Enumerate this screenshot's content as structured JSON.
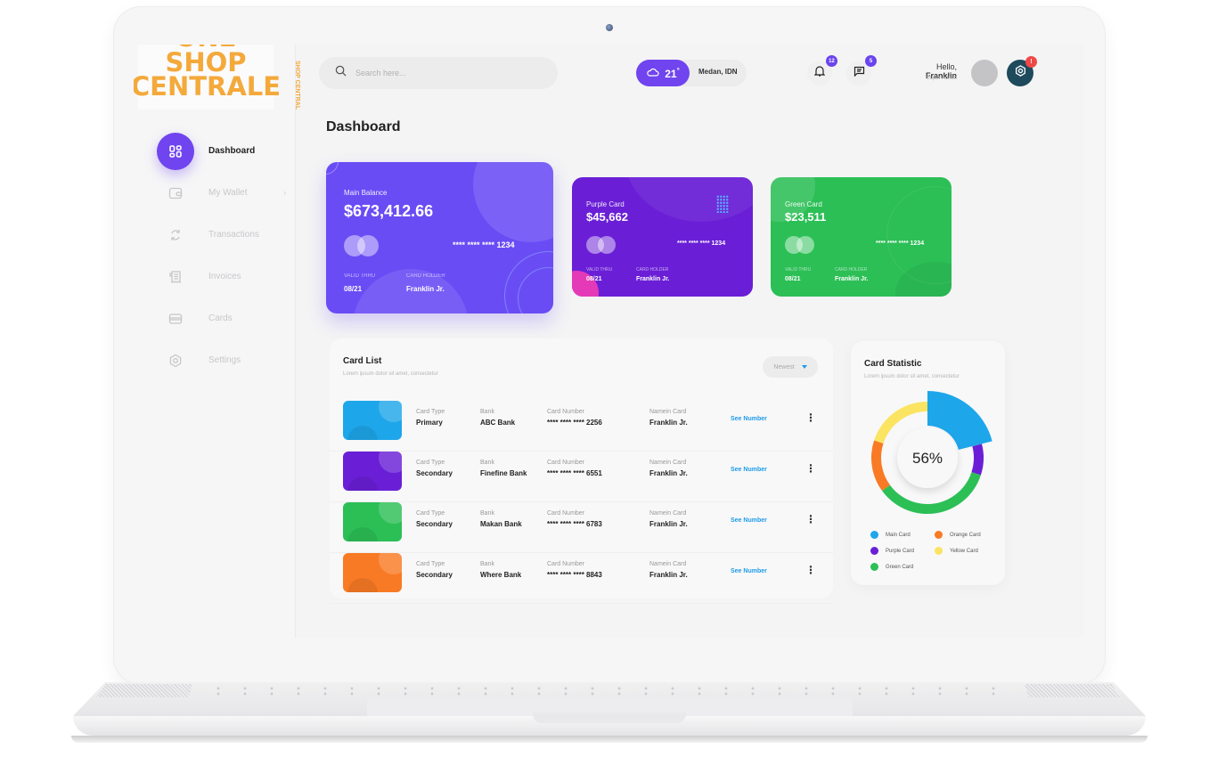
{
  "brand": {
    "logo_lines": [
      "ONE",
      "SHOP",
      "CENTRALE"
    ],
    "side_text": "SHOP CENTRAL",
    "color": "#f4a93b"
  },
  "sidebar": {
    "items": [
      {
        "label": "Dashboard",
        "icon": "dashboard-icon",
        "active": true
      },
      {
        "label": "My Wallet",
        "icon": "wallet-icon",
        "has_chevron": true
      },
      {
        "label": "Transactions",
        "icon": "transactions-icon"
      },
      {
        "label": "Invoices",
        "icon": "invoice-icon"
      },
      {
        "label": "Cards",
        "icon": "card-icon"
      },
      {
        "label": "Settings",
        "icon": "settings-icon"
      }
    ],
    "chevron": "›"
  },
  "header": {
    "search_placeholder": "Search here...",
    "weather": {
      "temp": "21",
      "degree": "°",
      "city": "Medan, IDN"
    },
    "notifications_count": "12",
    "messages_count": "5",
    "greeting": "Hello,",
    "user_name": "Franklin",
    "role": "Super Admin",
    "settings_badge": "!"
  },
  "page": {
    "title": "Dashboard"
  },
  "cards": [
    {
      "label": "Main Balance",
      "amount": "$673,412.66",
      "number": "**** **** **** 1234",
      "valid_label": "VALID THRU",
      "valid": "08/21",
      "holder_label": "CARD HOLDER",
      "holder": "Franklin Jr."
    },
    {
      "label": "Purple Card",
      "amount": "$45,662",
      "number": "**** **** **** 1234",
      "valid_label": "VALID THRU",
      "valid": "08/21",
      "holder_label": "CARD HOLDER",
      "holder": "Franklin Jr."
    },
    {
      "label": "Green Card",
      "amount": "$23,511",
      "number": "**** **** **** 1234",
      "valid_label": "VALID THRU",
      "valid": "08/21",
      "holder_label": "CARD HOLDER",
      "holder": "Franklin Jr."
    }
  ],
  "card_list": {
    "title": "Card List",
    "subtitle": "Lorem ipsum dolor sit amet, consectetur",
    "sort": "Newest",
    "columns": [
      "Card Type",
      "Bank",
      "Card Number",
      "Namein Card"
    ],
    "action": "See Number",
    "more": "⋮",
    "rows": [
      {
        "type": "Primary",
        "bank": "ABC Bank",
        "number": "**** **** **** 2256",
        "name": "Franklin Jr.",
        "color": "#1ea6ea"
      },
      {
        "type": "Secondary",
        "bank": "Finefine Bank",
        "number": "**** **** **** 6551",
        "name": "Franklin Jr.",
        "color": "#6a1fd6"
      },
      {
        "type": "Secondary",
        "bank": "Makan Bank",
        "number": "**** **** **** 6783",
        "name": "Franklin Jr.",
        "color": "#2cbf56"
      },
      {
        "type": "Secondary",
        "bank": "Where Bank",
        "number": "**** **** **** 8843",
        "name": "Franklin Jr.",
        "color": "#f97a24"
      }
    ]
  },
  "card_statistic": {
    "title": "Card Statistic",
    "subtitle": "Lorem ipsum dolor sit amet, consectetur",
    "center_label": "56%",
    "segments": [
      {
        "name": "Main Card",
        "value": 21,
        "color": "#1ea6ea",
        "highlighted": true
      },
      {
        "name": "Purple Card",
        "value": 9,
        "color": "#6a1fd6"
      },
      {
        "name": "Green Card",
        "value": 35,
        "color": "#2cbf56"
      },
      {
        "name": "Orange Card",
        "value": 15,
        "color": "#f97a24"
      },
      {
        "name": "Yellow Card",
        "value": 20,
        "color": "#fbe462"
      }
    ]
  }
}
